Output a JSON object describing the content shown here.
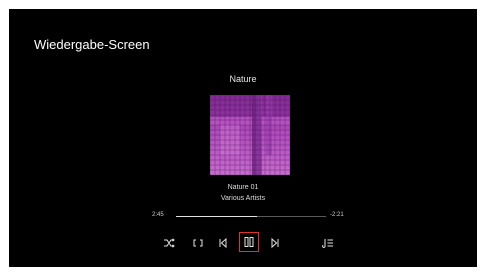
{
  "screen": {
    "title": "Wiedergabe-Screen"
  },
  "player": {
    "playlist_title": "Nature",
    "track_title": "Nature 01",
    "artist": "Various Artists",
    "elapsed": "2:45",
    "remaining": "-2:21",
    "progress": 0.54,
    "cover_art": "purple-pixel-grid"
  },
  "controls": {
    "shuffle_icon": "shuffle-icon",
    "repeat_icon": "repeat-icon",
    "previous_icon": "previous-icon",
    "play_pause_icon": "pause-icon",
    "next_icon": "next-icon",
    "queue_icon": "queue-icon",
    "accent_color": "#e0332b"
  }
}
